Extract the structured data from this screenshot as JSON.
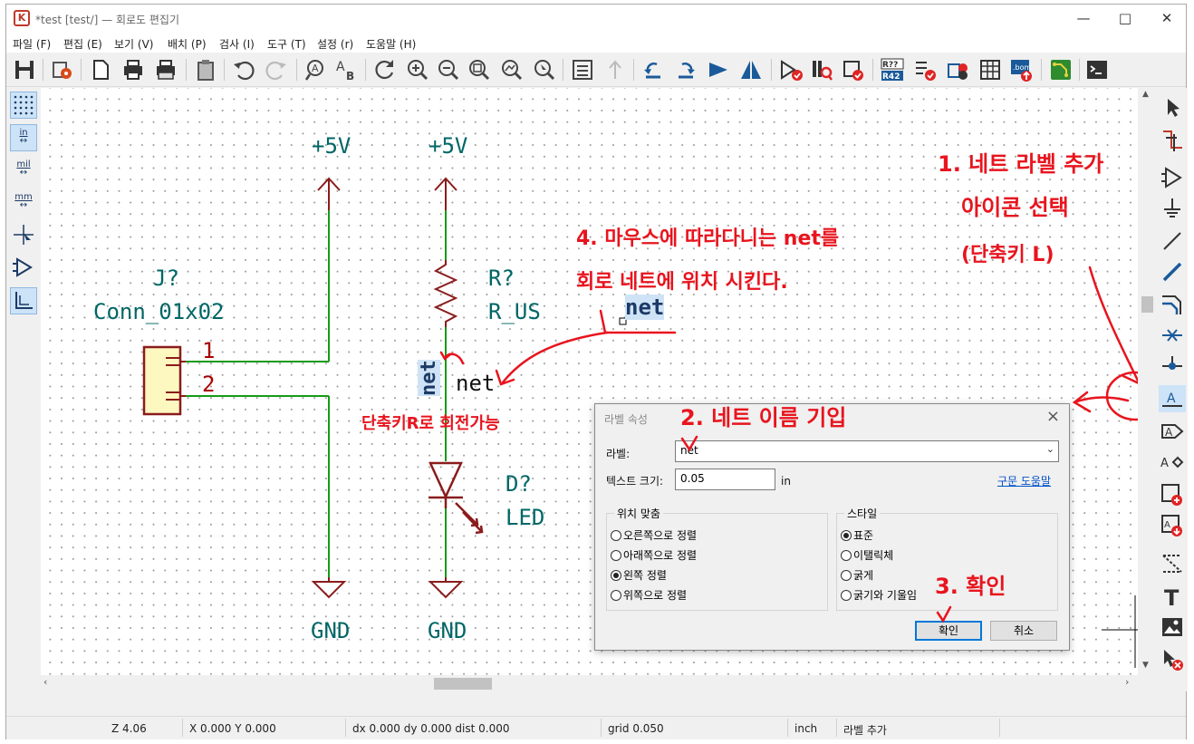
{
  "window": {
    "title": "*test [test/] — 회로도 편집기"
  },
  "window_controls": [
    "minimize-icon",
    "maximize-icon",
    "close-icon"
  ],
  "menu": [
    "파일 (F)",
    "편집 (E)",
    "보기 (V)",
    "배치 (P)",
    "검사 (I)",
    "도구 (T)",
    "설정 (r)",
    "도움말 (H)"
  ],
  "toolbar_icons": [
    "save-icon",
    "schematic-setup-icon",
    "page-settings-icon",
    "print-icon",
    "plot-icon",
    "paste-icon",
    "undo-icon",
    "redo-icon",
    "find-icon",
    "find-replace-icon",
    "refresh-icon",
    "zoom-in-icon",
    "zoom-out-icon",
    "zoom-fit-icon",
    "zoom-objects-icon",
    "zoom-tool-icon",
    "hierarchy-navigator-icon",
    "leave-sheet-icon",
    "rotate-ccw-icon",
    "rotate-cw-icon",
    "mirror-vertical-icon",
    "mirror-horizontal-icon",
    "symbol-editor-icon",
    "symbol-browser-icon",
    "footprint-editor-icon",
    "annotate-icon",
    "erc-icon",
    "assign-footprints-icon",
    "edit-fields-icon",
    "bom-icon",
    "pcb-editor-icon",
    "scripting-console-icon"
  ],
  "left_tools": {
    "grid_icon": "grid-icon",
    "units": [
      "in",
      "mil",
      "mm"
    ],
    "others": [
      "cursor-shape-icon",
      "hidden-pins-icon",
      "free-angle-wire-icon"
    ]
  },
  "right_tools": [
    "select-icon",
    "highlight-net-icon",
    "add-symbol-icon",
    "add-power-icon",
    "add-wire-icon",
    "add-bus-icon",
    "wire-to-bus-entry-icon",
    "no-connect-icon",
    "add-junction-icon",
    "add-net-label-icon",
    "add-global-label-icon",
    "add-hierarchical-label-icon",
    "add-sheet-icon",
    "import-sheet-pin-icon",
    "add-dashed-line-icon",
    "add-text-icon",
    "add-image-icon",
    "delete-icon"
  ],
  "schematic": {
    "power_left": "+5V",
    "power_right": "+5V",
    "gnd_left": "GND",
    "gnd_right": "GND",
    "connector_ref": "J?",
    "connector_value": "Conn_01x02",
    "pin1": "1",
    "pin2": "2",
    "resistor_ref": "R?",
    "resistor_value": "R_US",
    "diode_ref": "D?",
    "diode_value": "LED",
    "label_placed": "net",
    "label_rotated": "net",
    "label_cursor": "net"
  },
  "annotations": {
    "step1_line1": "1. 네트 라벨 추가",
    "step1_line2": "아이콘 선택",
    "step1_line3": "(단축키 L)",
    "step2": "2. 네트 이름 기입",
    "step3": "3. 확인",
    "step4_line1": "4. 마우스에 따라다니는 net를",
    "step4_line2": "회로 네트에 위치 시킨다.",
    "rotate_hint": "단축키R로 회전가능"
  },
  "dialog": {
    "title": "라벨 속성",
    "label_caption": "라벨:",
    "label_value": "net",
    "text_size_caption": "텍스트 크기:",
    "text_size_value": "0.05",
    "text_size_unit": "in",
    "help_link": "구문 도움말",
    "justify_group": "위치 맞춤",
    "justify_options": [
      "오른쪽으로 정렬",
      "아래쪽으로 정렬",
      "왼쪽 정렬",
      "위쪽으로 정렬"
    ],
    "justify_selected": 2,
    "style_group": "스타일",
    "style_options": [
      "표준",
      "이탤릭체",
      "굵게",
      "굵기와 기울임"
    ],
    "style_selected": 0,
    "ok_label": "확인",
    "cancel_label": "취소"
  },
  "status": {
    "zoom": "Z 4.06",
    "xy": "X 0.000  Y 0.000",
    "delta": "dx 0.000  dy 0.000  dist 0.000",
    "grid": "grid 0.050",
    "units": "inch",
    "tool": "라벨 추가"
  }
}
